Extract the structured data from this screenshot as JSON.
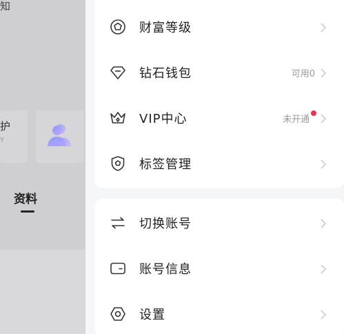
{
  "background": {
    "top_text": "知",
    "card_text": "护",
    "card_sub": "Y",
    "tab_label": "资料"
  },
  "menu_group_1": [
    {
      "label": "财富等级",
      "value": "",
      "icon": "badge-icon"
    },
    {
      "label": "钻石钱包",
      "value": "可用0",
      "icon": "diamond-icon"
    },
    {
      "label": "VIP中心",
      "value": "未开通",
      "icon": "crown-icon",
      "dot": true
    },
    {
      "label": "标签管理",
      "value": "",
      "icon": "tag-shield-icon"
    }
  ],
  "menu_group_2": [
    {
      "label": "切换账号",
      "value": "",
      "icon": "switch-arrows-icon"
    },
    {
      "label": "账号信息",
      "value": "",
      "icon": "card-icon"
    },
    {
      "label": "设置",
      "value": "",
      "icon": "gear-hexagon-icon"
    }
  ],
  "colors": {
    "accent_dot": "#f0304f",
    "text_primary": "#222222",
    "text_secondary": "#9a9a9a",
    "avatar_gradient": [
      "#7b8cff",
      "#b89cff"
    ]
  }
}
